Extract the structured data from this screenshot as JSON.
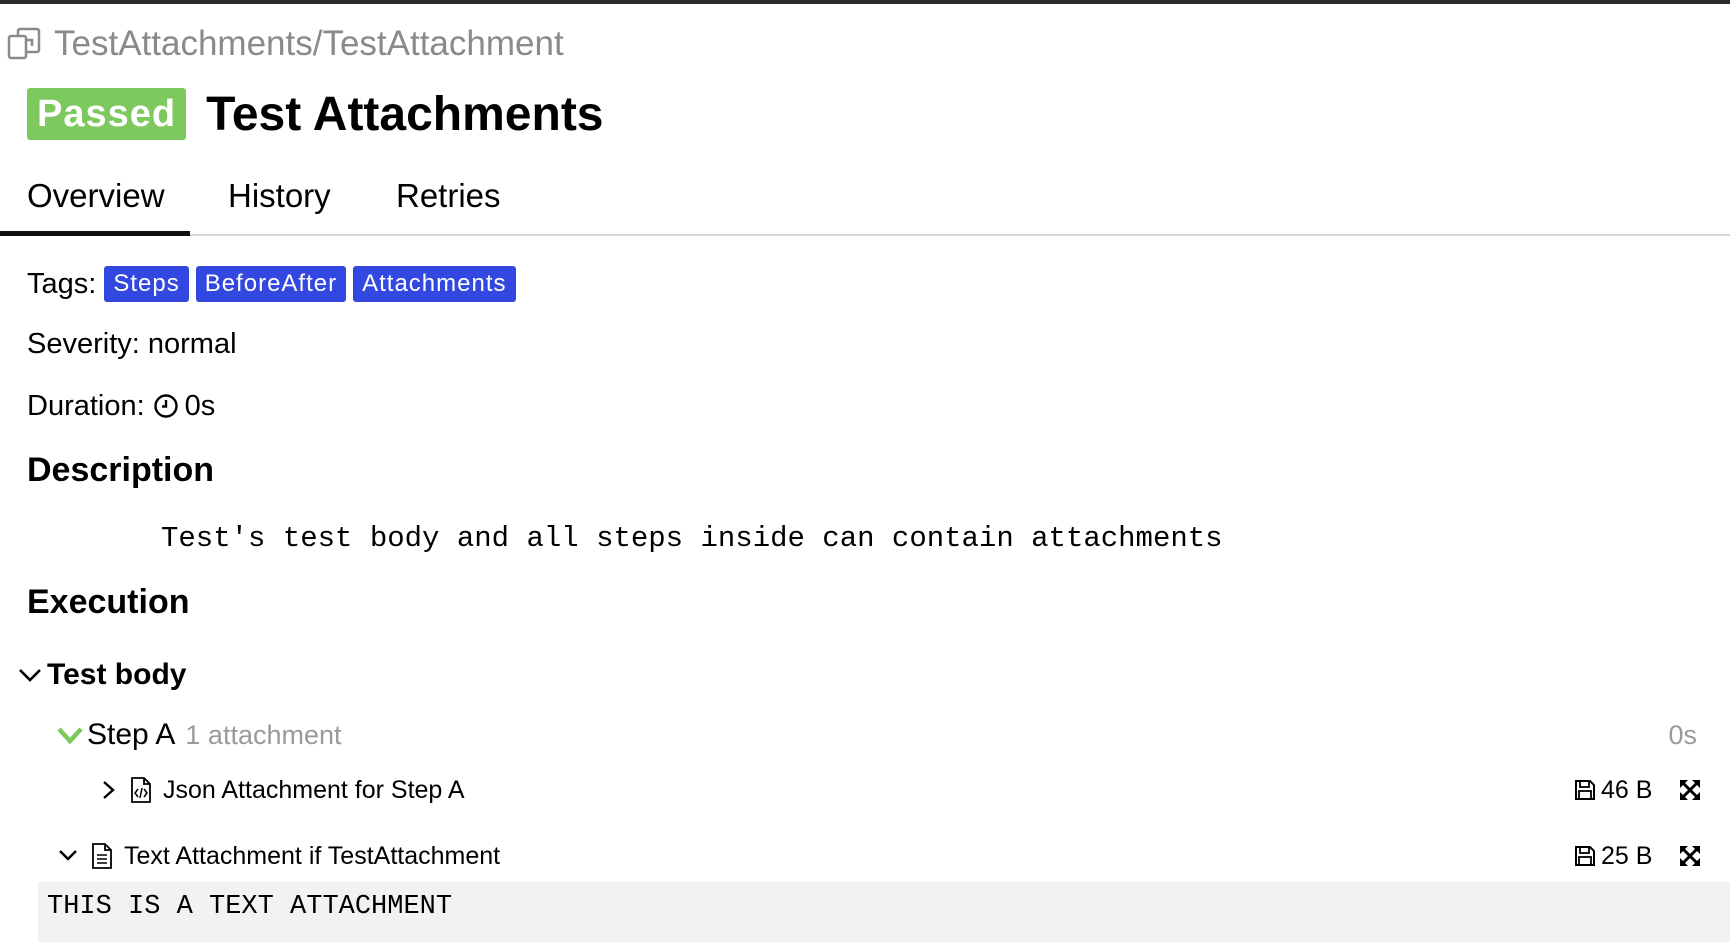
{
  "breadcrumb": {
    "text": "TestAttachments/TestAttachment",
    "icon": "copy-icon"
  },
  "header": {
    "status": "Passed",
    "status_color": "#7dc95e",
    "title": "Test Attachments"
  },
  "tabs": [
    {
      "label": "Overview",
      "active": true
    },
    {
      "label": "History",
      "active": false
    },
    {
      "label": "Retries",
      "active": false
    }
  ],
  "tags": {
    "label": "Tags:",
    "items": [
      "Steps",
      "BeforeAfter",
      "Attachments"
    ],
    "color": "#3348e0"
  },
  "severity": {
    "text": "Severity: normal"
  },
  "duration": {
    "label": "Duration:",
    "icon": "clock-icon",
    "value": "0s"
  },
  "description": {
    "heading": "Description",
    "text": "Test's test body and all steps inside can contain attachments"
  },
  "execution": {
    "heading": "Execution",
    "test_body": {
      "label": "Test body",
      "expanded": true,
      "steps": [
        {
          "name": "Step A",
          "attachment_count": "1 attachment",
          "duration": "0s",
          "status_icon": "check-chevron-icon",
          "status_color": "#7dc95e",
          "attachments": [
            {
              "name": "Json Attachment for Step A",
              "size": "46 B",
              "expanded": false,
              "icon": "json-file-icon"
            }
          ]
        }
      ],
      "attachments": [
        {
          "name": "Text Attachment if TestAttachment",
          "size": "25 B",
          "expanded": true,
          "icon": "text-file-icon",
          "content": "THIS IS A TEXT ATTACHMENT"
        }
      ]
    }
  }
}
